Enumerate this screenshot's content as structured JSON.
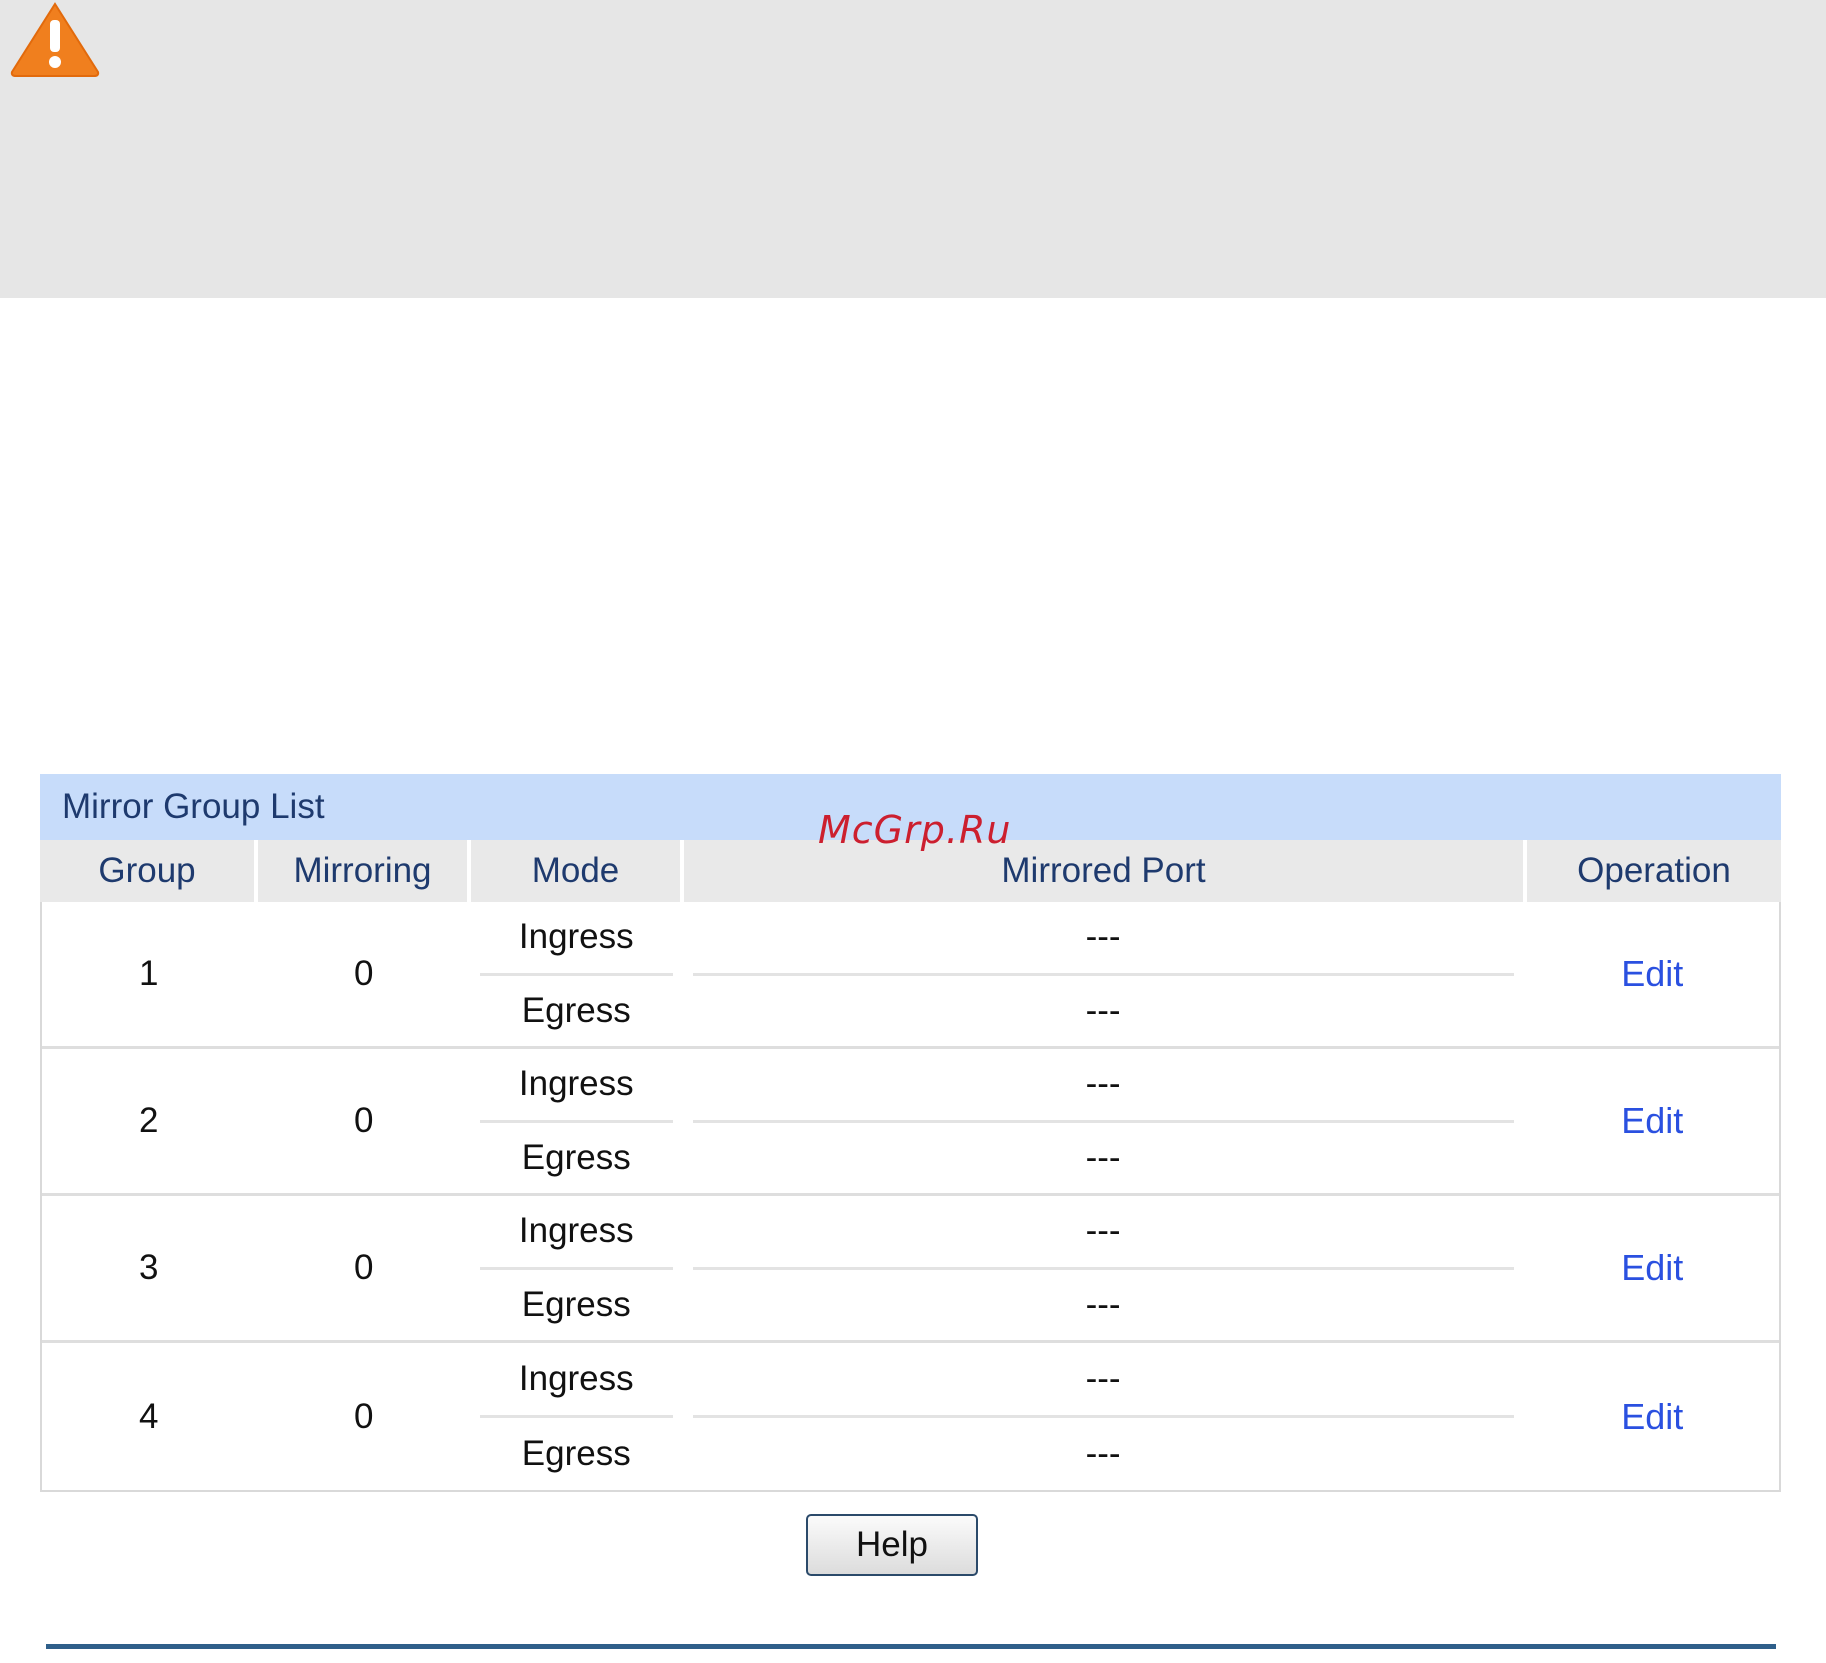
{
  "warning": {
    "icon": "warning-triangle-icon",
    "icon_color": "#f07f1e"
  },
  "watermark": "McGrp.Ru",
  "table": {
    "title": "Mirror Group List",
    "headers": {
      "group": "Group",
      "mirroring": "Mirroring",
      "mode": "Mode",
      "mirrored_port": "Mirrored Port",
      "operation": "Operation"
    },
    "rows": [
      {
        "group": "1",
        "mirroring": "0",
        "mode_ingress": "Ingress",
        "mode_egress": "Egress",
        "port_ingress": "---",
        "port_egress": "---",
        "operation": "Edit"
      },
      {
        "group": "2",
        "mirroring": "0",
        "mode_ingress": "Ingress",
        "mode_egress": "Egress",
        "port_ingress": "---",
        "port_egress": "---",
        "operation": "Edit"
      },
      {
        "group": "3",
        "mirroring": "0",
        "mode_ingress": "Ingress",
        "mode_egress": "Egress",
        "port_ingress": "---",
        "port_egress": "---",
        "operation": "Edit"
      },
      {
        "group": "4",
        "mirroring": "0",
        "mode_ingress": "Ingress",
        "mode_egress": "Egress",
        "port_ingress": "---",
        "port_egress": "---",
        "operation": "Edit"
      }
    ]
  },
  "help_button": "Help",
  "colors": {
    "title_bar": "#c7dcfa",
    "header_bg": "#e9e9e9",
    "link": "#2a50e0",
    "rule": "#2f5f8a"
  }
}
